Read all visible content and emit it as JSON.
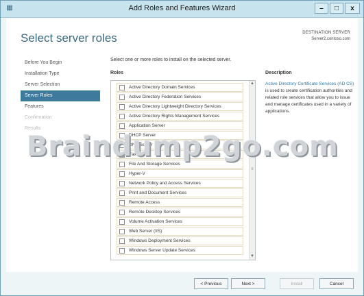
{
  "window": {
    "title": "Add Roles and Features Wizard",
    "minimize": "–",
    "maximize": "□",
    "close": "x"
  },
  "page": {
    "title": "Select server roles",
    "destination_label": "DESTINATION SERVER",
    "destination_server": "Server2.contoso.com"
  },
  "nav": {
    "items": [
      {
        "label": "Before You Begin",
        "state": "normal"
      },
      {
        "label": "Installation Type",
        "state": "normal"
      },
      {
        "label": "Server Selection",
        "state": "normal"
      },
      {
        "label": "Server Roles",
        "state": "active"
      },
      {
        "label": "Features",
        "state": "normal"
      },
      {
        "label": "Confirmation",
        "state": "disabled"
      },
      {
        "label": "Results",
        "state": "disabled"
      }
    ]
  },
  "main": {
    "instruction": "Select one or more roles to install on the selected server.",
    "roles_header": "Roles",
    "roles": [
      {
        "label": "Active Directory Domain Services",
        "checked": false
      },
      {
        "label": "Active Directory Federation Services",
        "checked": false
      },
      {
        "label": "Active Directory Lightweight Directory Services",
        "checked": false
      },
      {
        "label": "Active Directory Rights Management Services",
        "checked": false
      },
      {
        "label": "Application Server",
        "checked": false
      },
      {
        "label": "DHCP Server",
        "checked": false
      },
      {
        "label": "DNS Server",
        "checked": false
      },
      {
        "label": "Fax Server",
        "checked": false
      },
      {
        "label": "File And Storage Services",
        "checked": false
      },
      {
        "label": "Hyper-V",
        "checked": false
      },
      {
        "label": "Network Policy and Access Services",
        "checked": false
      },
      {
        "label": "Print and Document Services",
        "checked": false
      },
      {
        "label": "Remote Access",
        "checked": false
      },
      {
        "label": "Remote Desktop Services",
        "checked": false
      },
      {
        "label": "Volume Activation Services",
        "checked": false
      },
      {
        "label": "Web Server (IIS)",
        "checked": false
      },
      {
        "label": "Windows Deployment Services",
        "checked": false
      },
      {
        "label": "Windows Server Update Services",
        "checked": false
      }
    ]
  },
  "description": {
    "header": "Description",
    "link_text": "Active Directory Certificate Services (AD CS)",
    "body": " is used to create certification authorities and related role services that allow you to issue and manage certificates used in a variety of applications."
  },
  "watermark": "Braindump2go.com",
  "footer": {
    "previous": "< Previous",
    "next": "Next >",
    "install": "Install",
    "cancel": "Cancel"
  }
}
